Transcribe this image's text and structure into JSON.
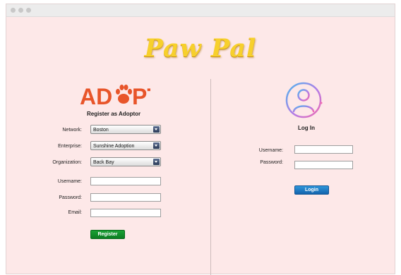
{
  "app": {
    "brand_title": "Paw Pal"
  },
  "adopt_logo": {
    "text_before": "AD",
    "text_after": "PT",
    "color": "#e8552a"
  },
  "register": {
    "heading": "Register as Adoptor",
    "network_label": "Network:",
    "network_value": "Boston",
    "enterprise_label": "Enterprise:",
    "enterprise_value": "Sunshine Adoption",
    "organization_label": "Organization:",
    "organization_value": "Back Bay",
    "username_label": "Username:",
    "username_value": "",
    "password_label": "Password:",
    "password_value": "",
    "email_label": "Email:",
    "email_value": "",
    "register_button": "Register"
  },
  "login": {
    "heading": "Log In",
    "username_label": "Username:",
    "username_value": "",
    "password_label": "Password:",
    "password_value": "",
    "login_button": "Login"
  },
  "icons": {
    "window_controls": [
      "close-dot",
      "minimize-dot",
      "zoom-dot"
    ],
    "adopt_logo_icon": "paw-print-icon",
    "login_icon": "user-avatar-icon",
    "dropdown_icon": "chevron-down-icon"
  },
  "colors": {
    "background": "#fde8e8",
    "brand_yellow": "#f7d02c",
    "register_green": "#128f2b",
    "login_blue": "#1d7ac4",
    "adopt_orange": "#e8552a"
  }
}
